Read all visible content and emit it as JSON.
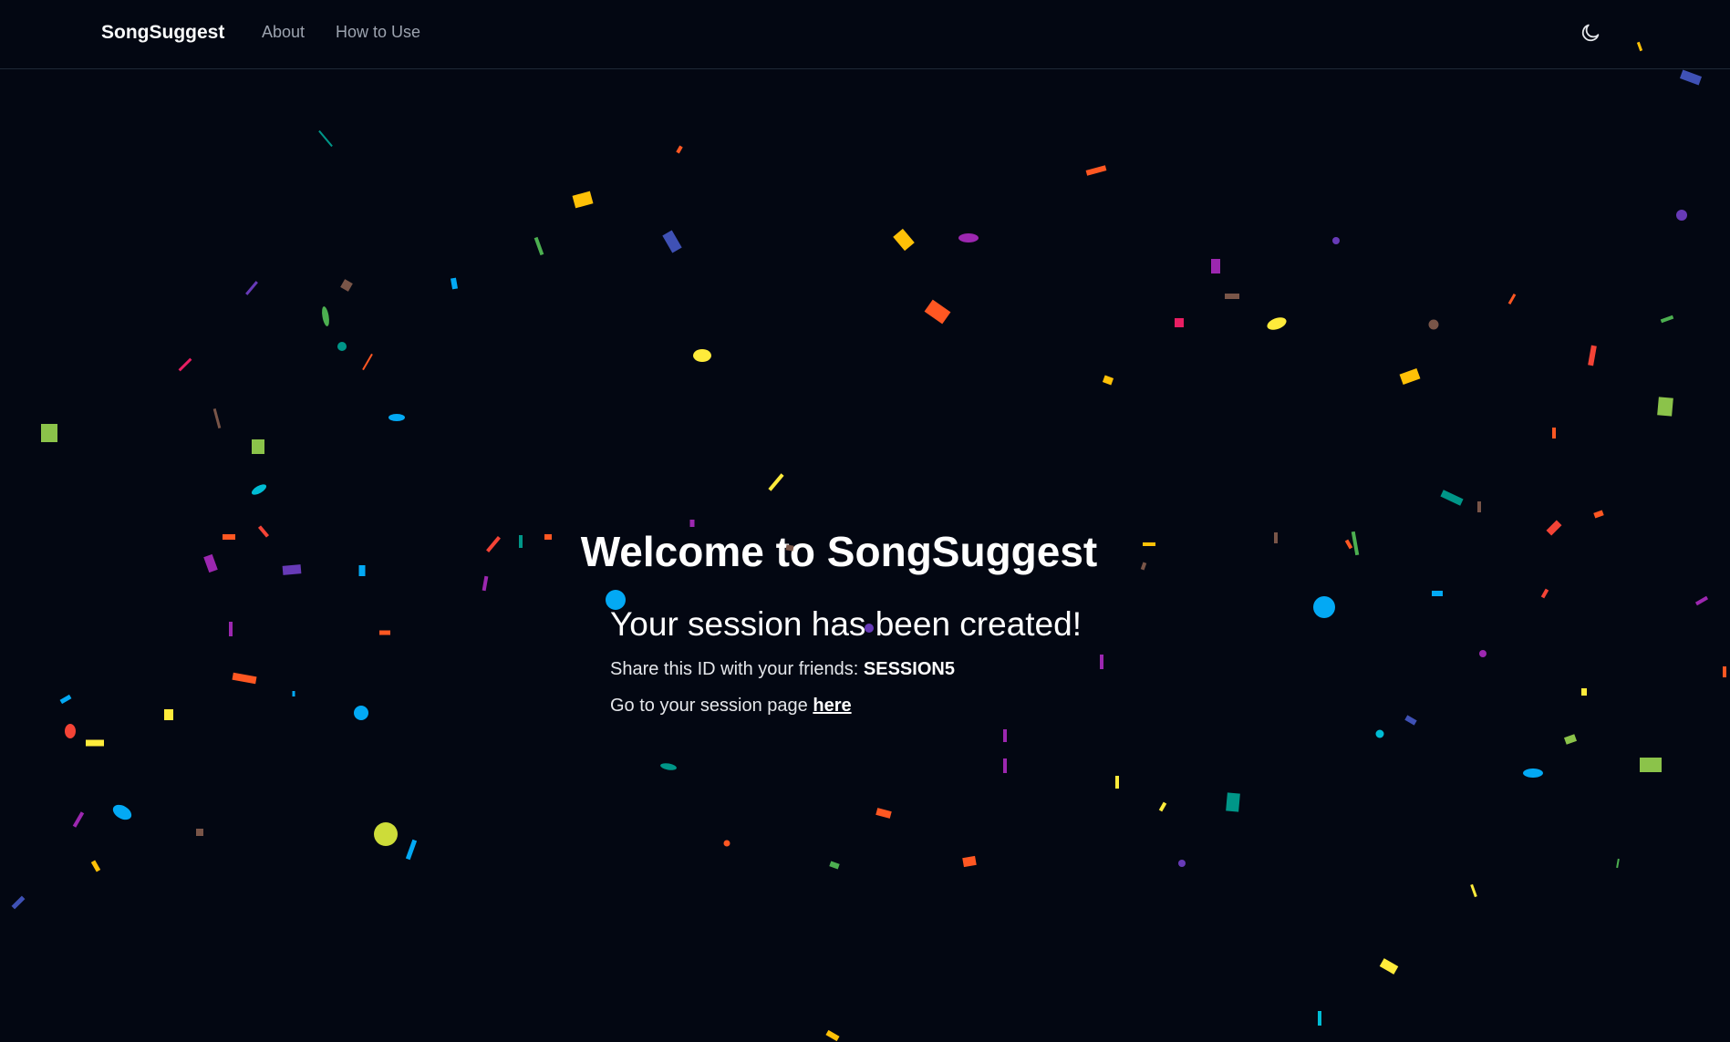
{
  "nav": {
    "brand": "SongSuggest",
    "links": [
      {
        "label": "About"
      },
      {
        "label": "How to Use"
      }
    ],
    "theme_toggle_icon": "moon-icon"
  },
  "main": {
    "title": "Welcome to SongSuggest",
    "subtitle": "Your session has been created!",
    "share_prefix": "Share this ID with your friends:",
    "session_id": "SESSION5",
    "go_prefix": "Go to your session page",
    "go_link": "here"
  },
  "colors": {
    "background": "#030712",
    "text": "#f9fafb",
    "muted": "#9ca3af",
    "border": "#1f2937"
  },
  "confetti_palette": [
    "#f44336",
    "#ff5722",
    "#ffc107",
    "#ffeb3b",
    "#cddc39",
    "#8bc34a",
    "#4caf50",
    "#009688",
    "#00bcd4",
    "#03a9f4",
    "#3f51b5",
    "#673ab7",
    "#9c27b0",
    "#e91e63",
    "#795548"
  ]
}
